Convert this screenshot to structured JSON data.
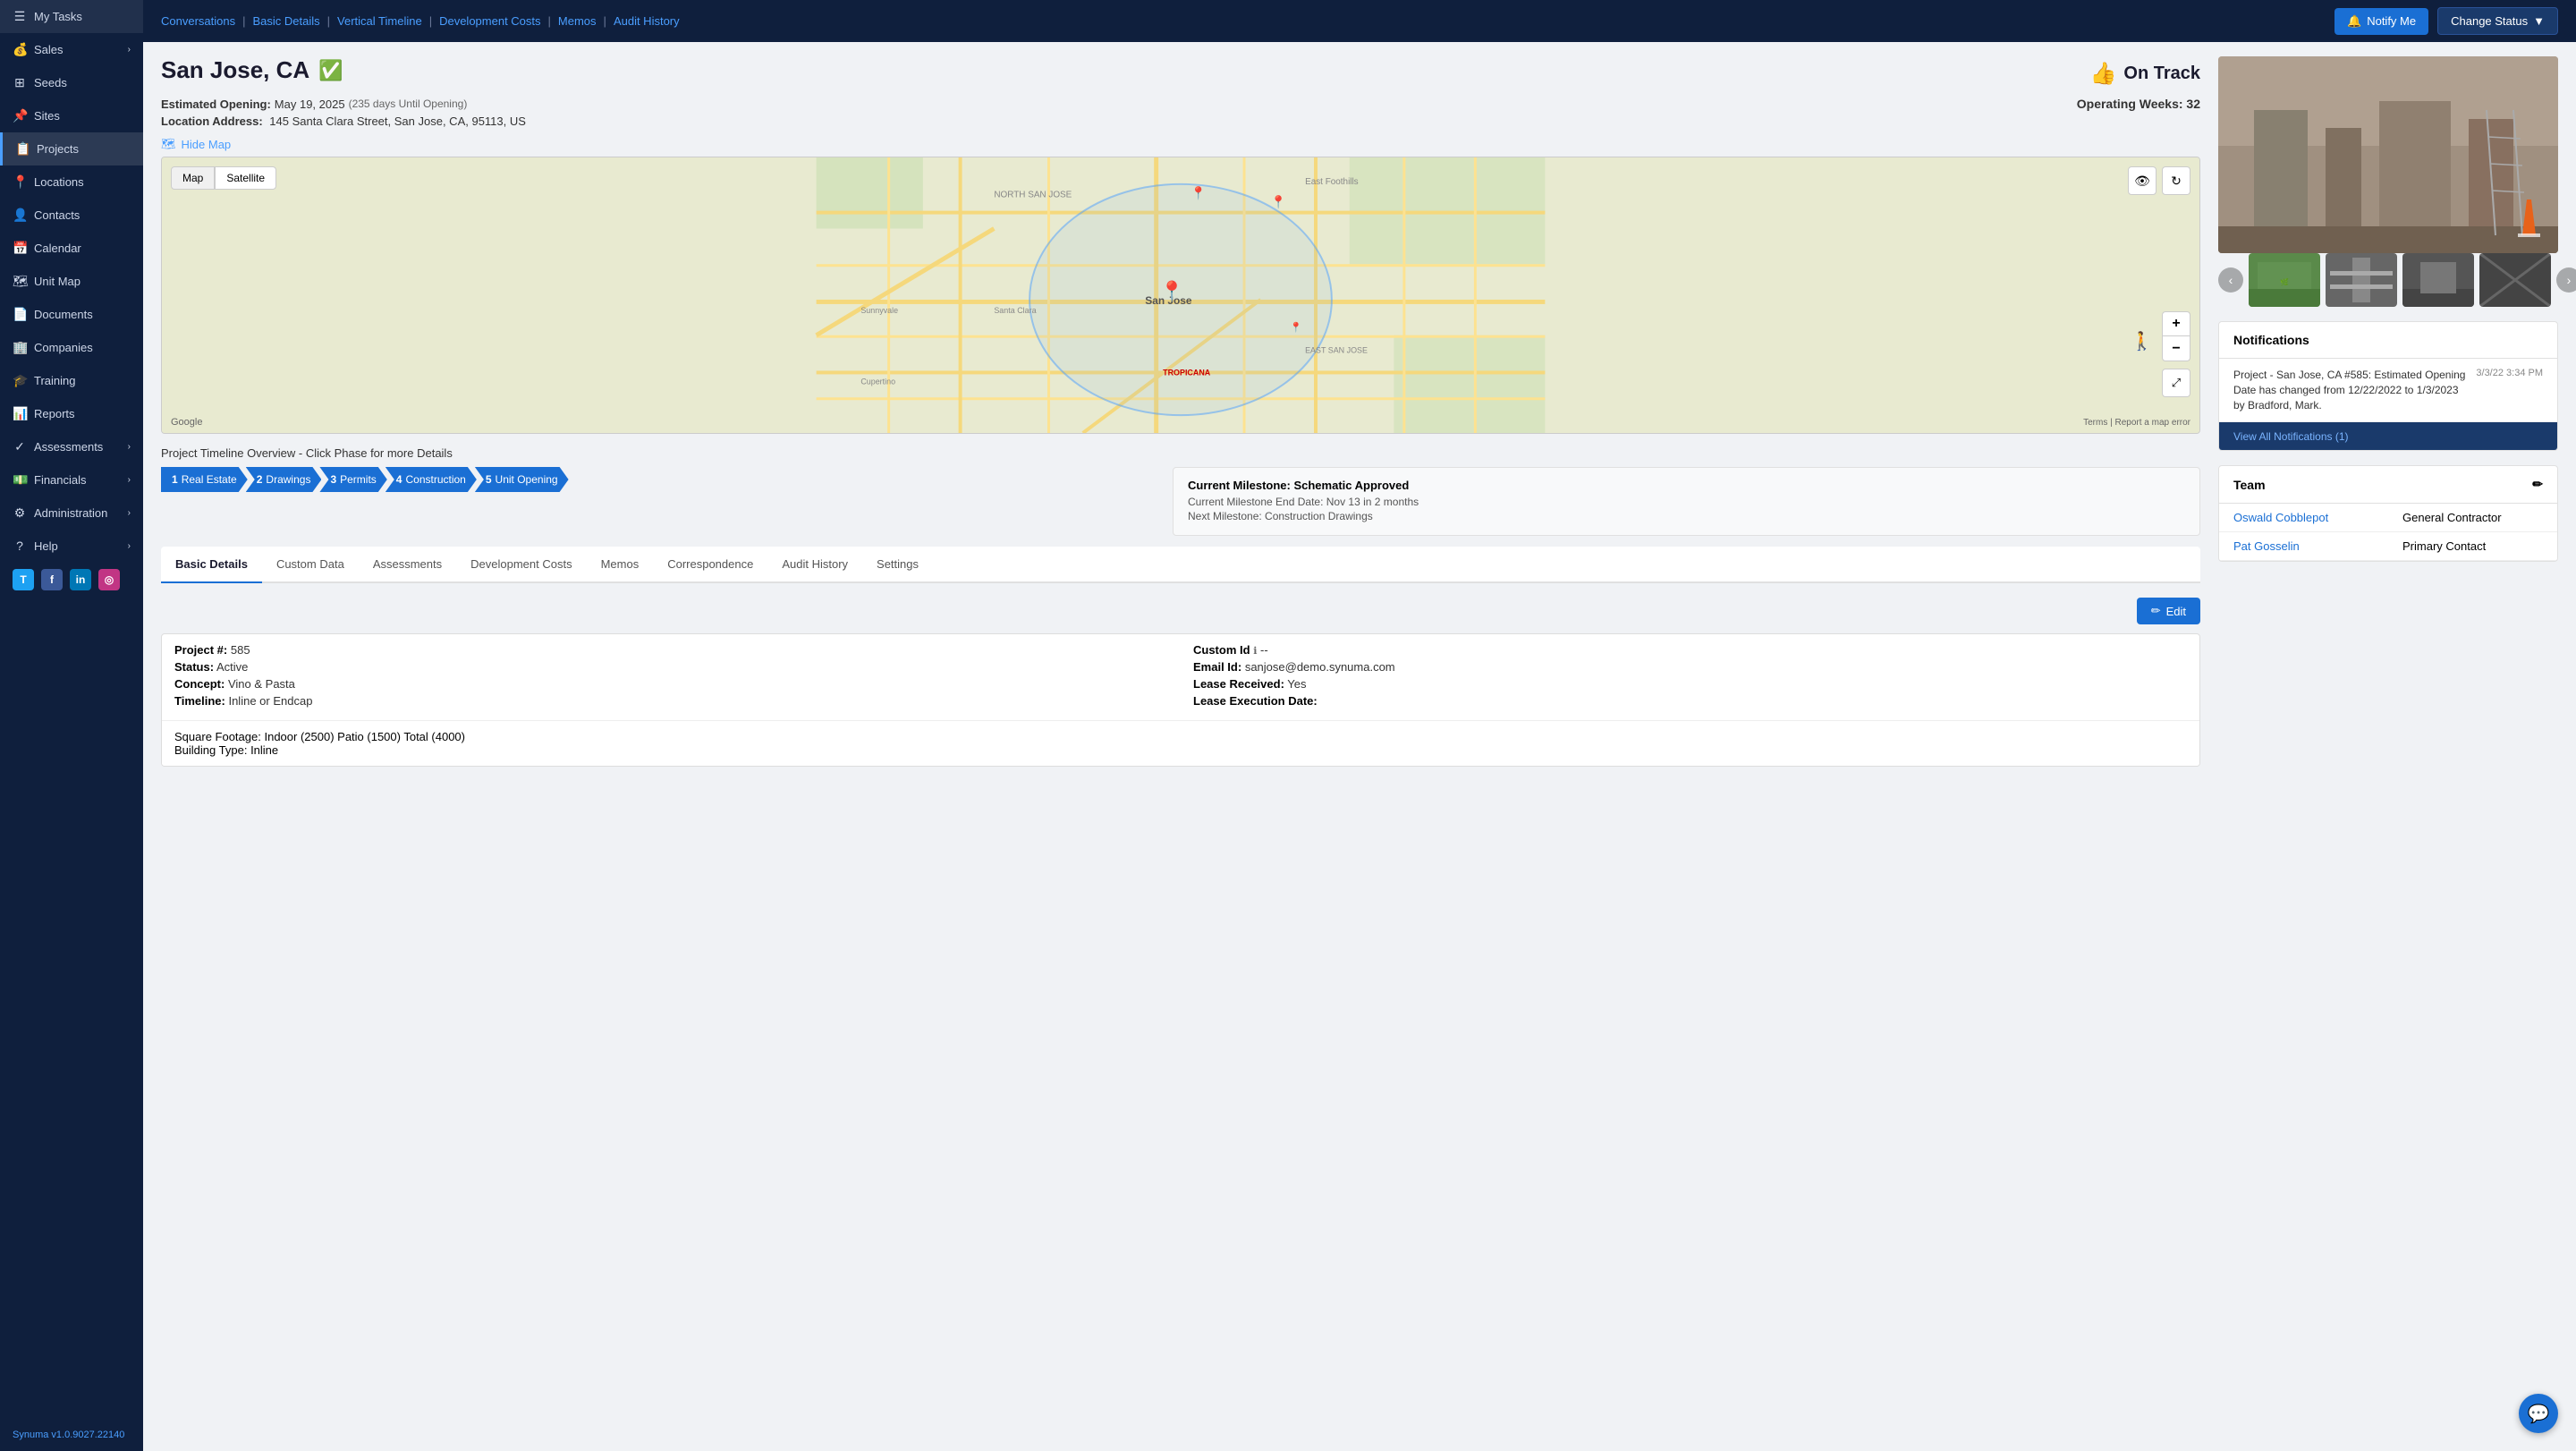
{
  "sidebar": {
    "items": [
      {
        "id": "my-tasks",
        "label": "My Tasks",
        "icon": "☰",
        "active": false
      },
      {
        "id": "sales",
        "label": "Sales",
        "icon": "💰",
        "active": false,
        "hasChevron": true
      },
      {
        "id": "seeds",
        "label": "Seeds",
        "icon": "⊞",
        "active": false
      },
      {
        "id": "sites",
        "label": "Sites",
        "icon": "📌",
        "active": false
      },
      {
        "id": "projects",
        "label": "Projects",
        "icon": "📋",
        "active": true
      },
      {
        "id": "locations",
        "label": "Locations",
        "icon": "📍",
        "active": false
      },
      {
        "id": "contacts",
        "label": "Contacts",
        "icon": "👤",
        "active": false
      },
      {
        "id": "calendar",
        "label": "Calendar",
        "icon": "📅",
        "active": false
      },
      {
        "id": "unit-map",
        "label": "Unit Map",
        "icon": "🗺",
        "active": false
      },
      {
        "id": "documents",
        "label": "Documents",
        "icon": "📄",
        "active": false
      },
      {
        "id": "companies",
        "label": "Companies",
        "icon": "🏢",
        "active": false
      },
      {
        "id": "training",
        "label": "Training",
        "icon": "🎓",
        "active": false
      },
      {
        "id": "reports",
        "label": "Reports",
        "icon": "📊",
        "active": false
      },
      {
        "id": "assessments",
        "label": "Assessments",
        "icon": "✓",
        "active": false,
        "hasChevron": true
      },
      {
        "id": "financials",
        "label": "Financials",
        "icon": "💵",
        "active": false,
        "hasChevron": true
      },
      {
        "id": "administration",
        "label": "Administration",
        "icon": "⚙",
        "active": false,
        "hasChevron": true
      },
      {
        "id": "help",
        "label": "Help",
        "icon": "?",
        "active": false,
        "hasChevron": true
      }
    ],
    "version": "Synuma v1.0.9027.22140"
  },
  "topnav": {
    "links": [
      {
        "label": "Conversations"
      },
      {
        "label": "Basic Details"
      },
      {
        "label": "Vertical Timeline"
      },
      {
        "label": "Development Costs"
      },
      {
        "label": "Memos"
      },
      {
        "label": "Audit History"
      }
    ],
    "notify_label": "Notify Me",
    "change_status_label": "Change Status"
  },
  "header": {
    "title": "San Jose, CA",
    "on_track_label": "On Track",
    "estimated_opening_label": "Estimated Opening:",
    "estimated_opening_date": "May 19, 2025",
    "estimated_opening_days": "(235 days Until Opening)",
    "operating_weeks_label": "Operating Weeks:",
    "operating_weeks_value": "32",
    "address_label": "Location Address:",
    "address_value": "145 Santa Clara Street, San Jose, CA, 95113, US",
    "map_toggle_label": "Hide Map"
  },
  "map": {
    "map_btn": "Map",
    "satellite_btn": "Satellite"
  },
  "timeline": {
    "title": "Project Timeline Overview - Click Phase for more Details",
    "phases": [
      {
        "num": "1",
        "label": "Real Estate"
      },
      {
        "num": "2",
        "label": "Drawings"
      },
      {
        "num": "3",
        "label": "Permits"
      },
      {
        "num": "4",
        "label": "Construction"
      },
      {
        "num": "5",
        "label": "Unit Opening"
      }
    ],
    "milestone_title": "Current Milestone: Schematic Approved",
    "milestone_end": "Current Milestone End Date: Nov 13 in 2 months",
    "milestone_next": "Next Milestone: Construction Drawings"
  },
  "tabs": [
    {
      "id": "basic-details",
      "label": "Basic Details",
      "active": true
    },
    {
      "id": "custom-data",
      "label": "Custom Data",
      "active": false
    },
    {
      "id": "assessments",
      "label": "Assessments",
      "active": false
    },
    {
      "id": "development-costs",
      "label": "Development Costs",
      "active": false
    },
    {
      "id": "memos",
      "label": "Memos",
      "active": false
    },
    {
      "id": "correspondence",
      "label": "Correspondence",
      "active": false
    },
    {
      "id": "audit-history",
      "label": "Audit History",
      "active": false
    },
    {
      "id": "settings",
      "label": "Settings",
      "active": false
    }
  ],
  "details": {
    "edit_label": "Edit",
    "left": [
      {
        "label": "Project #:",
        "value": "585"
      },
      {
        "label": "Status:",
        "value": "Active"
      },
      {
        "label": "Concept:",
        "value": "Vino & Pasta"
      },
      {
        "label": "Timeline:",
        "value": "Inline or Endcap"
      }
    ],
    "right": [
      {
        "label": "Custom Id",
        "value": "--",
        "has_info": true
      },
      {
        "label": "Email Id:",
        "value": "sanjose@demo.synuma.com"
      },
      {
        "label": "Lease Received:",
        "value": "Yes"
      },
      {
        "label": "Lease Execution Date:",
        "value": ""
      }
    ],
    "bottom": [
      {
        "label": "Square Footage:",
        "value": "Indoor (2500) Patio (1500) Total (4000)"
      },
      {
        "label": "Building Type:",
        "value": "Inline"
      }
    ]
  },
  "notifications": {
    "title": "Notifications",
    "items": [
      {
        "text": "Project - San Jose, CA #585: Estimated Opening Date has changed from 12/22/2022 to 1/3/2023 by Bradford, Mark.",
        "date": "3/3/22 3:34 PM"
      }
    ],
    "view_all_label": "View All Notifications (1)"
  },
  "team": {
    "title": "Team",
    "members": [
      {
        "name": "Oswald Cobblepot",
        "role": "General Contractor"
      },
      {
        "name": "Pat Gosselin",
        "role": "Primary Contact"
      }
    ]
  }
}
